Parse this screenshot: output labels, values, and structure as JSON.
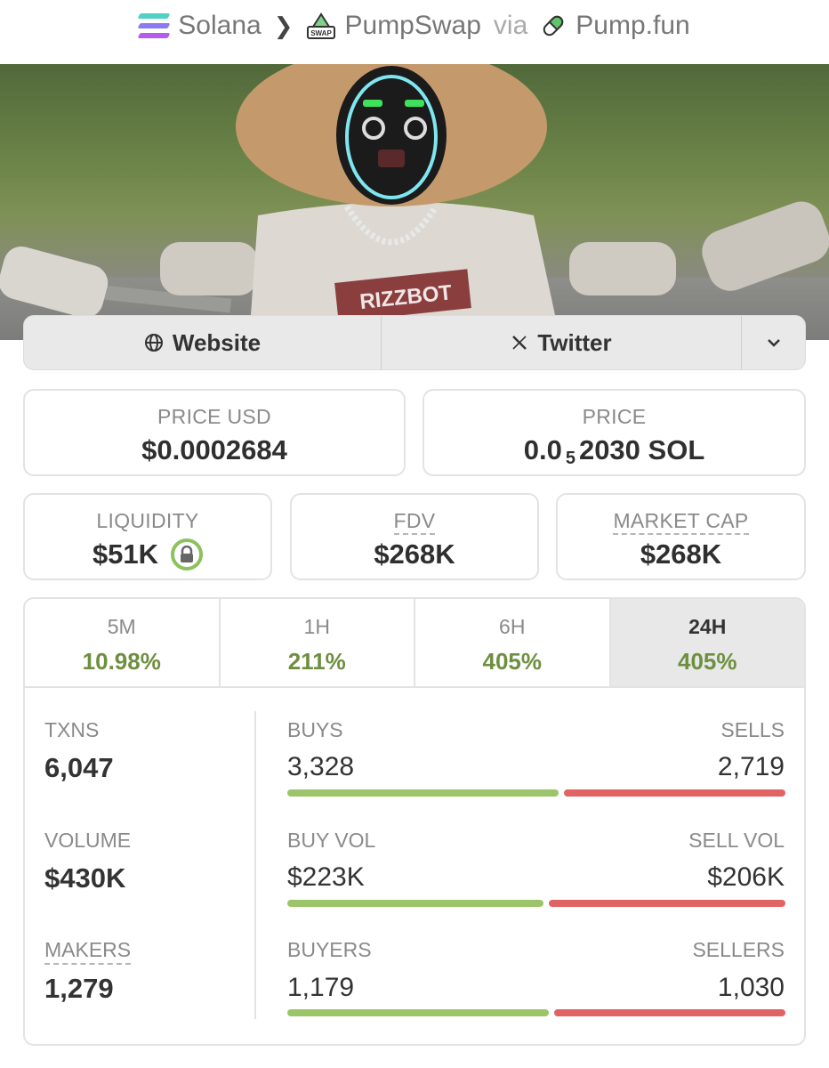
{
  "breadcrumb": {
    "chain": "Solana",
    "dex": "PumpSwap",
    "via": "via",
    "launchpad": "Pump.fun"
  },
  "banner": {
    "shirt_text": "RIZZBOT"
  },
  "links": {
    "website": "Website",
    "twitter": "Twitter"
  },
  "price_usd": {
    "label": "PRICE USD",
    "value": "$0.0002684"
  },
  "price_native": {
    "label": "PRICE",
    "prefix": "0.0",
    "zeros": "5",
    "digits": "2030",
    "unit": "SOL"
  },
  "liquidity": {
    "label": "LIQUIDITY",
    "value": "$51K"
  },
  "fdv": {
    "label": "FDV",
    "value": "$268K"
  },
  "market_cap": {
    "label": "MARKET CAP",
    "value": "$268K"
  },
  "timeframes": [
    {
      "label": "5M",
      "change": "10.98%"
    },
    {
      "label": "1H",
      "change": "211%"
    },
    {
      "label": "6H",
      "change": "405%"
    },
    {
      "label": "24H",
      "change": "405%"
    }
  ],
  "active_timeframe": "24H",
  "stats": {
    "txns": {
      "label": "TXNS",
      "value": "6,047"
    },
    "volume": {
      "label": "VOLUME",
      "value": "$430K"
    },
    "makers": {
      "label": "MAKERS",
      "value": "1,279"
    },
    "buys": {
      "label": "BUYS",
      "value": "3,328",
      "share": 0.55
    },
    "sells": {
      "label": "SELLS",
      "value": "2,719"
    },
    "buy_vol": {
      "label": "BUY VOL",
      "value": "$223K",
      "share": 0.52
    },
    "sell_vol": {
      "label": "SELL VOL",
      "value": "$206K"
    },
    "buyers": {
      "label": "BUYERS",
      "value": "1,179",
      "share": 0.53
    },
    "sellers": {
      "label": "SELLERS",
      "value": "1,030"
    }
  },
  "colors": {
    "positive": "#6e8f3f",
    "buy_bar": "#9cc56a",
    "sell_bar": "#e06464",
    "lock_ring": "#8dc05f"
  }
}
